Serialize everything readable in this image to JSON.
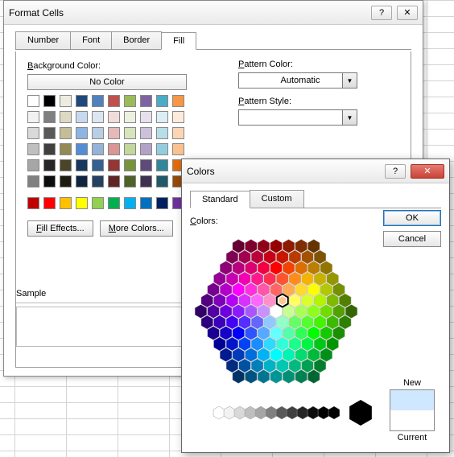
{
  "format_cells": {
    "title": "Format Cells",
    "tabs": {
      "number": "Number",
      "font": "Font",
      "border": "Border",
      "fill": "Fill"
    },
    "active_tab": "fill",
    "bg_color_label": "Background Color:",
    "no_color": "No Color",
    "fill_effects": "Fill Effects...",
    "more_colors": "More Colors...",
    "pattern_color_label": "Pattern Color:",
    "pattern_color_value": "Automatic",
    "pattern_style_label": "Pattern Style:",
    "sample_label": "Sample",
    "theme_rows": [
      [
        "#ffffff",
        "#000000",
        "#eeece1",
        "#1f497d",
        "#4f81bd",
        "#c0504d",
        "#9bbb59",
        "#8064a2",
        "#4bacc6",
        "#f79646"
      ],
      [
        "#f2f2f2",
        "#808080",
        "#ddd9c3",
        "#c6d9f1",
        "#dce6f2",
        "#f2dcdb",
        "#ebf1de",
        "#e6e0ec",
        "#dbeef4",
        "#fdeada"
      ],
      [
        "#d9d9d9",
        "#595959",
        "#c4bd97",
        "#8eb4e3",
        "#b9cde5",
        "#e6b9b8",
        "#d7e4bd",
        "#ccc1da",
        "#b7dee8",
        "#fcd5b5"
      ],
      [
        "#bfbfbf",
        "#404040",
        "#948a54",
        "#538dd5",
        "#95b3d7",
        "#d99694",
        "#c3d69b",
        "#b3a2c7",
        "#93cddd",
        "#fac090"
      ],
      [
        "#a6a6a6",
        "#262626",
        "#4a452a",
        "#17375e",
        "#376092",
        "#963634",
        "#77933c",
        "#604a7b",
        "#31869b",
        "#e46c0a"
      ],
      [
        "#808080",
        "#0d0d0d",
        "#1e1c11",
        "#10243f",
        "#254061",
        "#632523",
        "#4f6228",
        "#403152",
        "#215968",
        "#984807"
      ]
    ],
    "standard_row": [
      "#c00000",
      "#ff0000",
      "#ffc000",
      "#ffff00",
      "#92d050",
      "#00b050",
      "#00b0f0",
      "#0070c0",
      "#002060",
      "#7030a0"
    ]
  },
  "colors": {
    "title": "Colors",
    "tabs": {
      "standard": "Standard",
      "custom": "Custom"
    },
    "active_tab": "standard",
    "colors_label": "Colors:",
    "ok": "OK",
    "cancel": "Cancel",
    "new_label": "New",
    "current_label": "Current",
    "gray_steps": [
      "#ffffff",
      "#f2f2f2",
      "#d9d9d9",
      "#bfbfbf",
      "#a6a6a6",
      "#808080",
      "#595959",
      "#404040",
      "#262626",
      "#0d0d0d",
      "#000000",
      "#000000"
    ],
    "big_hex": "#000000",
    "preview_new": "#cfe7ff",
    "preview_current": "#ffffff"
  }
}
